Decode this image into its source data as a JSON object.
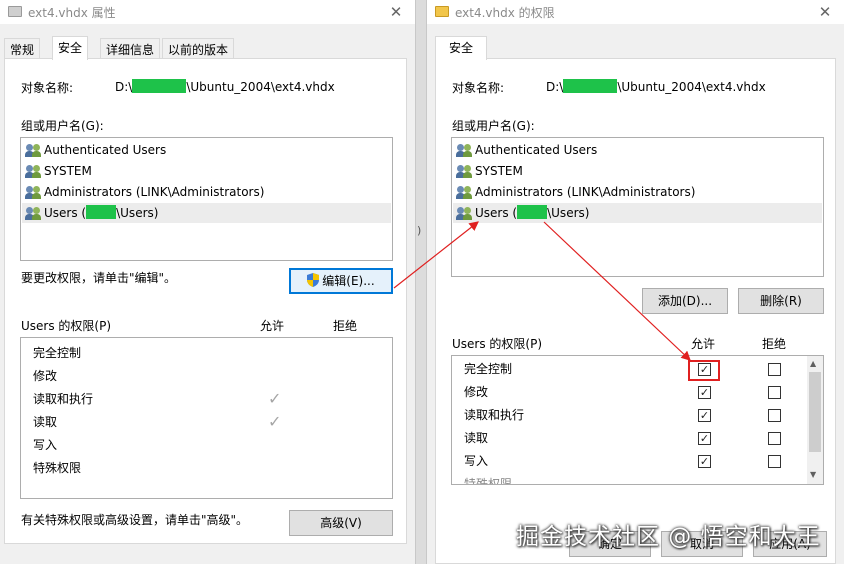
{
  "left": {
    "title": "ext4.vhdx 属性",
    "close": "✕",
    "tabs": [
      "常规",
      "安全",
      "详细信息",
      "以前的版本"
    ],
    "object_label": "对象名称:",
    "object_prefix": "D:\\",
    "object_suffix": "\\Ubuntu_2004\\ext4.vhdx",
    "group_label": "组或用户名(G):",
    "users": [
      "Authenticated Users",
      "SYSTEM",
      "Administrators (LINK\\Administrators)"
    ],
    "users_sel_prefix": "Users (",
    "users_sel_suffix": "\\Users)",
    "change_hint": "要更改权限，请单击\"编辑\"。",
    "edit_button": "编辑(E)...",
    "perm_title": "Users 的权限(P)",
    "allow": "允许",
    "deny": "拒绝",
    "perms": [
      "完全控制",
      "修改",
      "读取和执行",
      "读取",
      "写入",
      "特殊权限"
    ],
    "advanced_hint": "有关特殊权限或高级设置，请单击\"高级\"。",
    "advanced_button": "高级(V)"
  },
  "right": {
    "title": "ext4.vhdx 的权限",
    "close": "✕",
    "tab": "安全",
    "object_label": "对象名称:",
    "object_prefix": "D:\\",
    "object_suffix": "\\Ubuntu_2004\\ext4.vhdx",
    "group_label": "组或用户名(G):",
    "users": [
      "Authenticated Users",
      "SYSTEM",
      "Administrators (LINK\\Administrators)"
    ],
    "users_sel_prefix": "Users (",
    "users_sel_suffix": "\\Users)",
    "add_button": "添加(D)...",
    "remove_button": "删除(R)",
    "perm_title": "Users 的权限(P)",
    "allow": "允许",
    "deny": "拒绝",
    "perms": [
      "完全控制",
      "修改",
      "读取和执行",
      "读取",
      "写入",
      "特殊权限"
    ],
    "ok_button": "确定",
    "cancel_button": "取消",
    "apply_button": "应用(A)"
  },
  "gap_glyph": ")",
  "check_glyph": "✓",
  "watermark": "掘金技术社区 @ 悟空和大王",
  "colors": {
    "redaction": "#1ec24a",
    "annotation": "#e02020",
    "focus": "#0078d7"
  }
}
